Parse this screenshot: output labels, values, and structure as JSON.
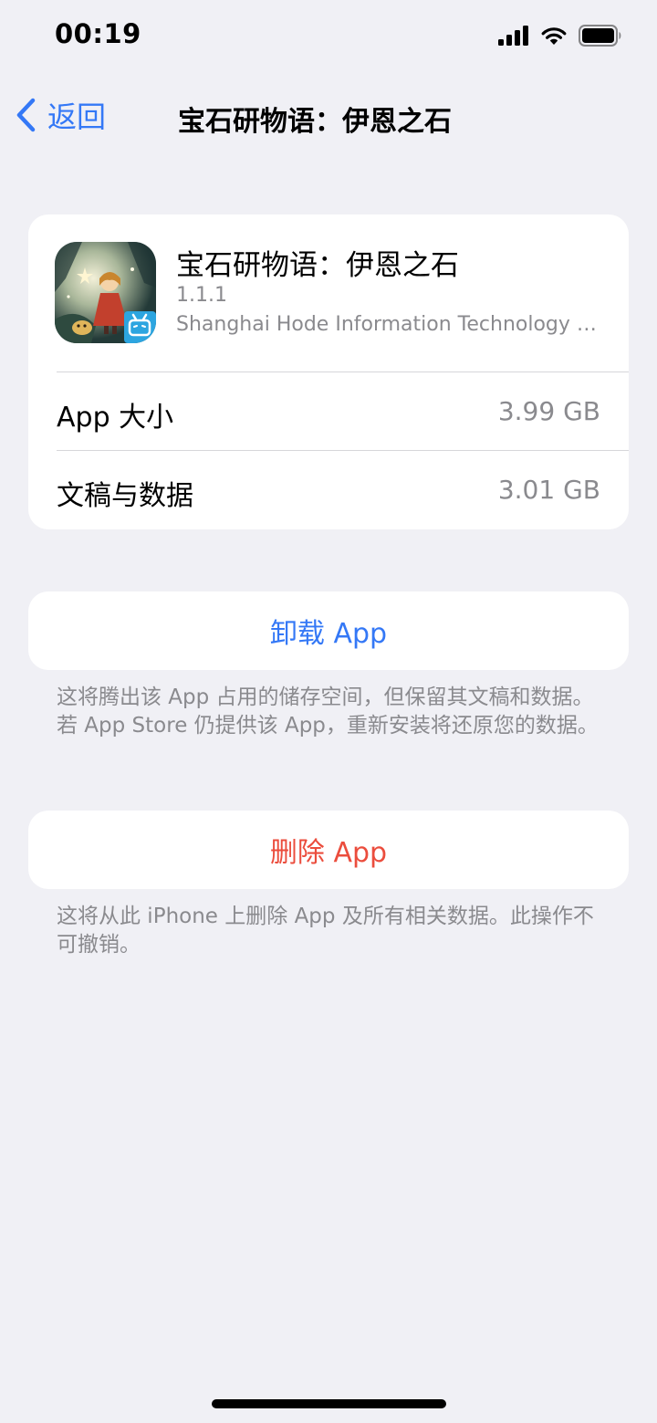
{
  "status_bar": {
    "time": "00:19"
  },
  "nav": {
    "back_label": "返回",
    "title": "宝石研物语：伊恩之石"
  },
  "app": {
    "name": "宝石研物语：伊恩之石",
    "version": "1.1.1",
    "developer": "Shanghai Hode Information Technology Co., Ltd."
  },
  "storage": [
    {
      "label": "App 大小",
      "value": "3.99 GB"
    },
    {
      "label": "文稿与数据",
      "value": "3.01 GB"
    }
  ],
  "offload": {
    "label": "卸载 App",
    "note": "这将腾出该 App 占用的储存空间，但保留其文稿和数据。若 App Store 仍提供该 App，重新安装将还原您的数据。"
  },
  "delete": {
    "label": "删除 App",
    "note": "这将从此 iPhone 上删除 App 及所有相关数据。此操作不可撤销。"
  },
  "colors": {
    "background": "#F0F0F5",
    "accent": "#3478F6",
    "destructive": "#EB4D3D",
    "secondary_text": "#8A8A8E"
  }
}
